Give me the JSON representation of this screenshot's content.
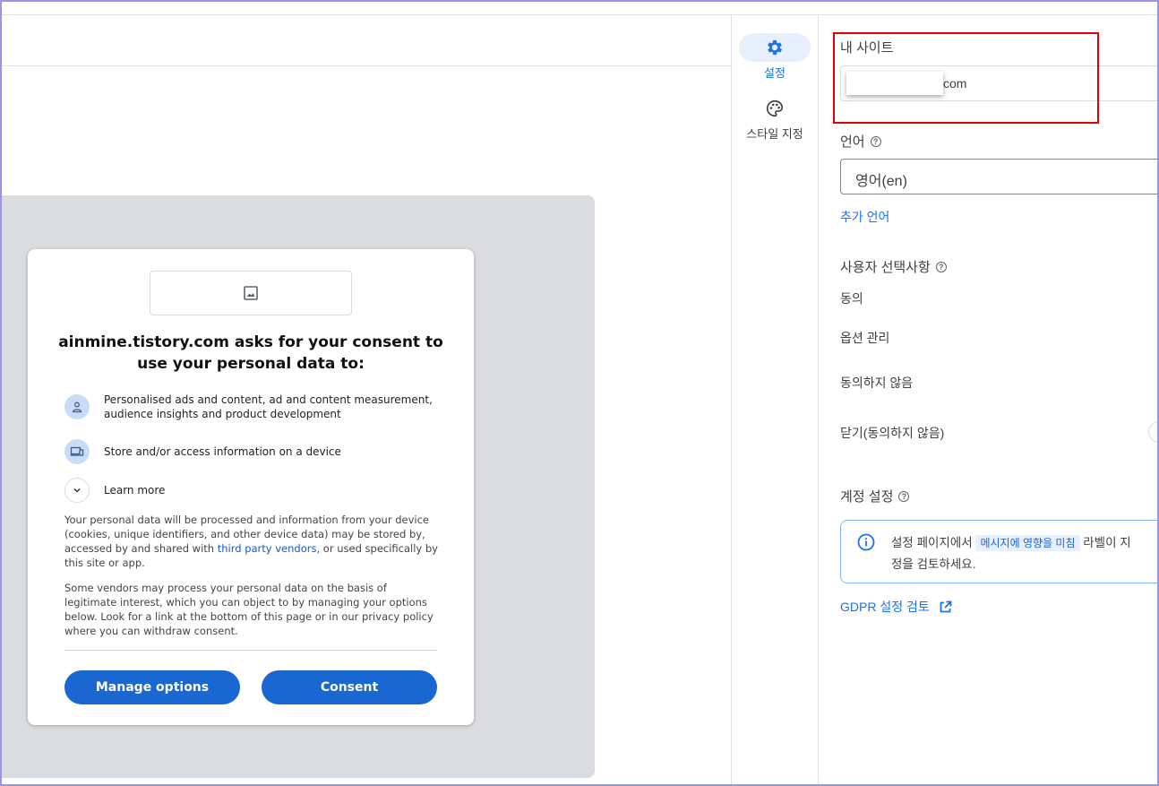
{
  "dialog": {
    "title": "ainmine.tistory.com asks for your consent to use your personal data to:",
    "purposes": [
      {
        "icon": "person-icon",
        "text": "Personalised ads and content, ad and content measurement, audience insights and product development"
      },
      {
        "icon": "devices-icon",
        "text": "Store and/or access information on a device"
      },
      {
        "icon": "chevron-down-icon",
        "text": "Learn more"
      }
    ],
    "paragraph1_pre": "Your personal data will be processed and information from your device (cookies, unique identifiers, and other device data) may be stored by, accessed by and shared with ",
    "paragraph1_link": "third party vendors",
    "paragraph1_post": ", or used specifically by this site or app.",
    "paragraph2": "Some vendors may process your personal data on the basis of legitimate interest, which you can object to by managing your options below. Look for a link at the bottom of this page or in our privacy policy where you can withdraw consent.",
    "manage_label": "Manage options",
    "consent_label": "Consent"
  },
  "rail": {
    "items": [
      {
        "label": "설정",
        "icon": "gear-icon",
        "active": true
      },
      {
        "label": "스타일 지정",
        "icon": "palette-icon",
        "active": false
      }
    ]
  },
  "settings": {
    "my_site_label": "내 사이트",
    "my_site_value_visible": "com",
    "language_label": "언어",
    "language_value": "영어(en)",
    "add_language": "추가 언어",
    "user_choices_label": "사용자 선택사항",
    "choices": [
      "동의",
      "옵션 관리",
      "동의하지 않음",
      "닫기(동의하지 않음)"
    ],
    "account_label": "계정 설정",
    "info_pre": "설정 페이지에서",
    "info_chip": "메시지에 영향을 미침",
    "info_post": "라벨이 지",
    "info_line2": "정을 검토하세요.",
    "gdpr_link": "GDPR 설정 검토"
  },
  "colors": {
    "accent": "#1a73e8",
    "consent_button": "#1a67d2",
    "highlight_border": "#e00000",
    "preview_background": "#dadce0"
  }
}
